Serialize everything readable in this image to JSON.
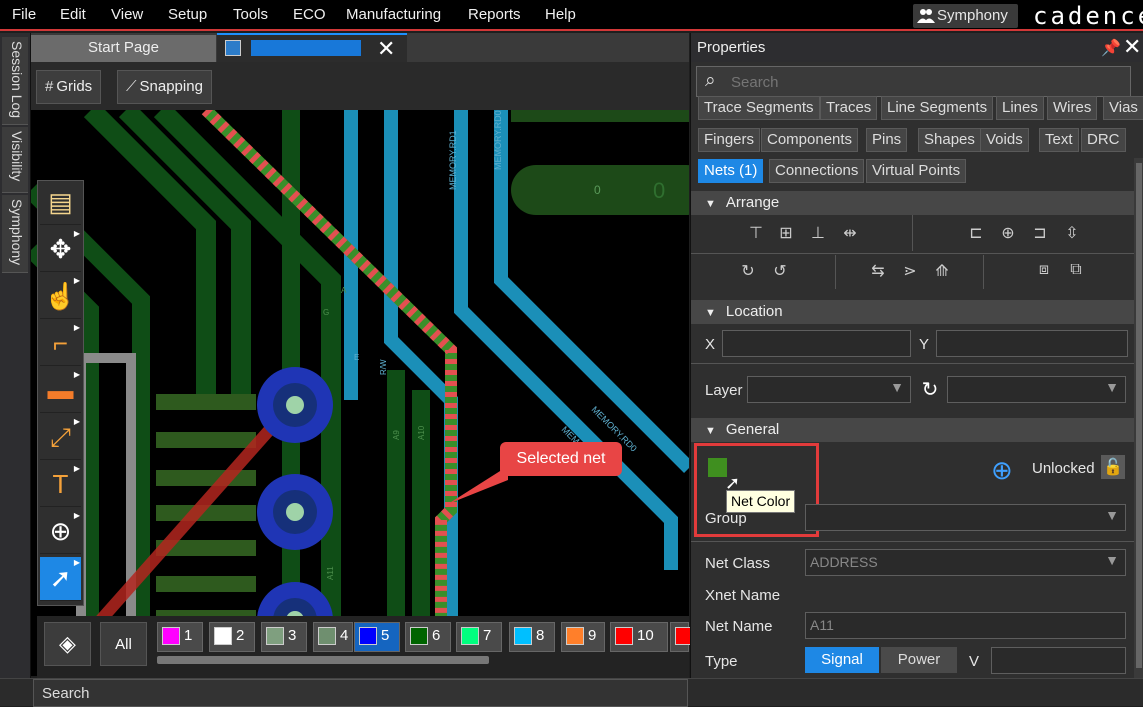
{
  "menu": [
    "File",
    "Edit",
    "View",
    "Setup",
    "Tools",
    "ECO",
    "Manufacturing",
    "Reports",
    "Help"
  ],
  "symphony_label": "Symphony",
  "brand": "cadence",
  "left_tabs": [
    "Session Log",
    "Visibility",
    "Symphony"
  ],
  "tabs": {
    "start": "Start Page",
    "doc_close": "✕"
  },
  "canvas_toolbar": {
    "grids": "Grids",
    "snapping": "Snapping"
  },
  "layer_bar": {
    "all": "All",
    "layers": [
      {
        "num": "1",
        "color": "#ff00ff"
      },
      {
        "num": "2",
        "color": "#ffffff"
      },
      {
        "num": "3",
        "color": "#7f9f7f"
      },
      {
        "num": "4",
        "color": "#6f8f6f"
      },
      {
        "num": "5",
        "color": "#0000ff",
        "active": true
      },
      {
        "num": "6",
        "color": "#006400"
      },
      {
        "num": "7",
        "color": "#00ff7f"
      },
      {
        "num": "8",
        "color": "#00bfff"
      },
      {
        "num": "9",
        "color": "#ff7f2a"
      },
      {
        "num": "10",
        "color": "#ff0000"
      }
    ]
  },
  "status_search": "Search",
  "callout": "Selected net",
  "canvas_labels": [
    "MEMORY.RD1",
    "MEMORY.RD0",
    "MEMORY.RD0",
    "MEMO",
    "R/W",
    "A9",
    "A10",
    "A11",
    "E",
    "G",
    "A",
    "0",
    "0"
  ],
  "properties": {
    "title": "Properties",
    "search_placeholder": "Search",
    "filters_row1": [
      "Trace Segments",
      "Traces",
      "Line Segments",
      "Lines",
      "Wires",
      "Vias"
    ],
    "filters_row2": [
      "Fingers",
      "Components",
      "Pins",
      "Shapes",
      "Voids",
      "Text",
      "DRC"
    ],
    "filters_row3": [
      "Nets (1)",
      "Connections",
      "Virtual Points"
    ],
    "sections": {
      "arrange": "Arrange",
      "location": "Location",
      "general": "General"
    },
    "location": {
      "x_label": "X",
      "y_label": "Y",
      "layer_label": "Layer"
    },
    "general": {
      "tooltip": "Net Color",
      "unlocked": "Unlocked",
      "group_label": "Group",
      "net_class_label": "Net Class",
      "net_class_value": "ADDRESS",
      "xnet_label": "Xnet Name",
      "net_name_label": "Net Name",
      "net_name_value": "A11",
      "type_label": "Type",
      "type_signal": "Signal",
      "type_power": "Power",
      "v_label": "V",
      "net_color": "#3f8f1f"
    }
  }
}
